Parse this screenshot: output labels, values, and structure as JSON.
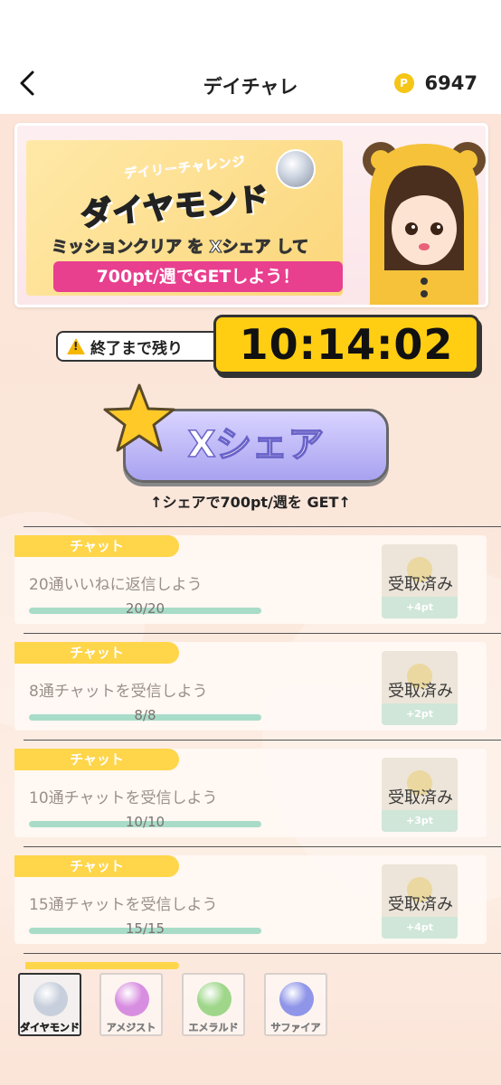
{
  "header": {
    "title": "デイチャレ",
    "points_icon": "P",
    "points": "6947"
  },
  "banner": {
    "subtitle": "デイリーチャレンジ",
    "title": "ダイヤモンド",
    "line1_a": "ミッションクリア を ",
    "line1_x": "X",
    "line1_b": "シェア して",
    "line2": "700pt/週でGETしよう！"
  },
  "timer": {
    "label": "終了まで残り",
    "value": "10:14:02"
  },
  "share": {
    "button_label": "Xシェア",
    "note": "↑シェアで700pt/週を GET↑"
  },
  "missions": [
    {
      "tag": "チャット",
      "text": "20通いいねに返信しよう",
      "progress": "20/20",
      "progress_fraction": 1.0,
      "status": "受取済み",
      "reward": "+4pt"
    },
    {
      "tag": "チャット",
      "text": "8通チャットを受信しよう",
      "progress": "8/8",
      "progress_fraction": 1.0,
      "status": "受取済み",
      "reward": "+2pt"
    },
    {
      "tag": "チャット",
      "text": "10通チャットを受信しよう",
      "progress": "10/10",
      "progress_fraction": 1.0,
      "status": "受取済み",
      "reward": "+3pt"
    },
    {
      "tag": "チャット",
      "text": "15通チャットを受信しよう",
      "progress": "15/15",
      "progress_fraction": 1.0,
      "status": "受取済み",
      "reward": "+4pt"
    }
  ],
  "gem_tabs": [
    {
      "label": "ダイヤモンド",
      "color": "#c8cfdc",
      "active": true
    },
    {
      "label": "アメジスト",
      "color": "#d88ee0",
      "active": false
    },
    {
      "label": "エメラルド",
      "color": "#9fd68a",
      "active": false
    },
    {
      "label": "サファイア",
      "color": "#8f95e8",
      "active": false
    }
  ],
  "colors": {
    "accent_yellow": "#ffcd12",
    "tag_yellow": "#ffd54a",
    "share_purple": "#a8a2f0",
    "banner_pink": "#e83f8f"
  }
}
